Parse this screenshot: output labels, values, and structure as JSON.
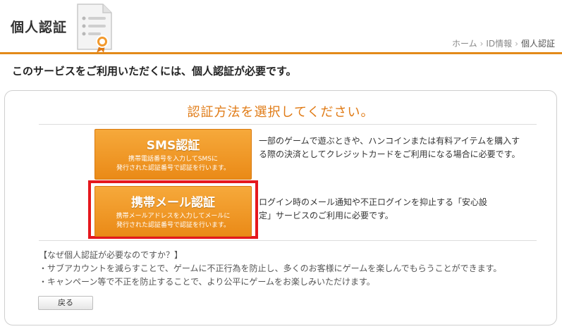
{
  "header": {
    "title": "個人認証",
    "breadcrumb": [
      "ホーム",
      "ID情報",
      "個人認証"
    ],
    "breadcrumb_sep": "›"
  },
  "subheading": "このサービスをご利用いただくには、個人認証が必要です。",
  "panel": {
    "heading": "認証方法を選択してください。",
    "sms": {
      "title": "SMS認証",
      "subtitle": "携帯電話番号を入力してSMSに\n発行された認証番号で認証を行います。",
      "description": "一部のゲームで遊ぶときや、ハンコインまたは有料アイテムを購入する際の決済としてクレジットカードをご利用になる場合に必要です。"
    },
    "mail": {
      "title": "携帯メール認証",
      "subtitle": "携帯メールアドレスを入力してメールに\n発行された認証番号で認証を行います。",
      "description": "ログイン時のメール通知や不正ログインを抑止する「安心設定」サービスのご利用に必要です。"
    },
    "why": {
      "heading": "【なぜ個人認証が必要なのですか？】",
      "items": [
        "・サブアカウントを減らすことで、ゲームに不正行為を防止し、多くのお客様にゲームを楽しんでもらうことができます。",
        "・キャンペーン等で不正を防止することで、より公平にゲームをお楽しみいただけます。"
      ]
    },
    "back_label": "戻る"
  },
  "colors": {
    "accent": "#e38a1a",
    "button_orange": "#f0961f",
    "highlight_red": "#e5171d"
  }
}
